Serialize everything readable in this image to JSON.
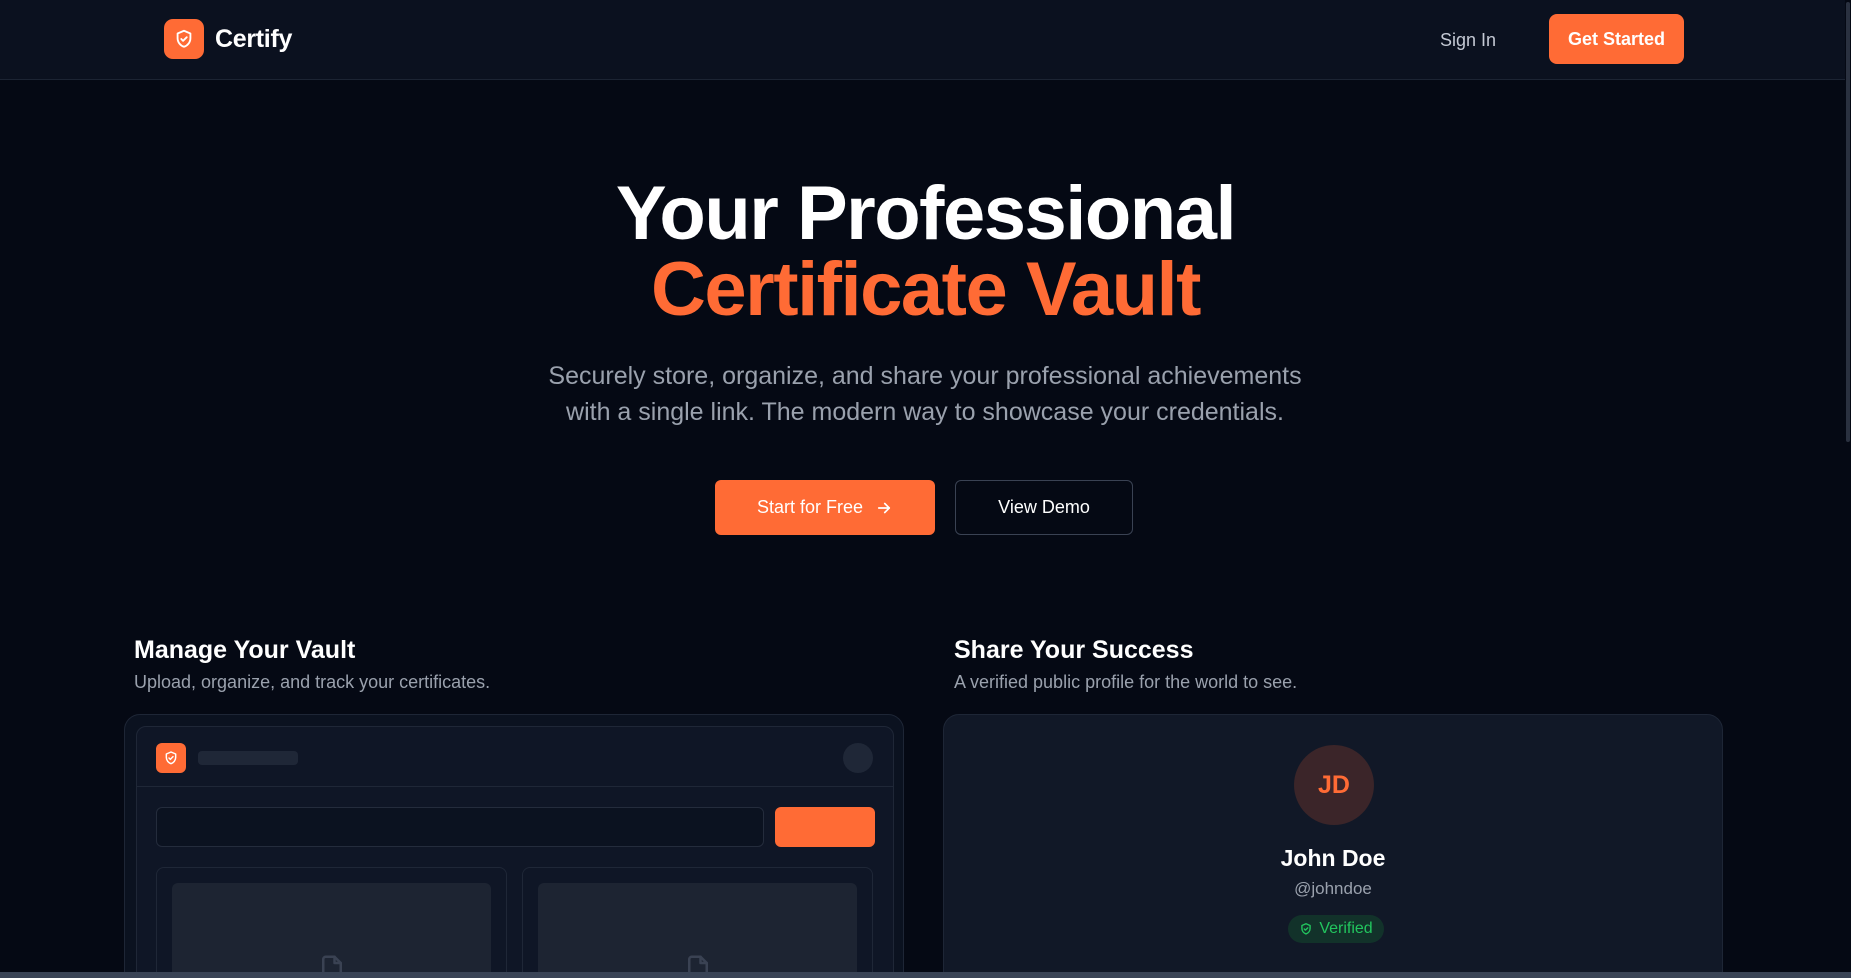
{
  "brand": {
    "name": "Certify",
    "accent": "#ff6b35",
    "icon": "shield-check-icon"
  },
  "nav": {
    "signin": "Sign In",
    "cta": "Get Started"
  },
  "hero": {
    "title_line1": "Your Professional",
    "title_line2": "Certificate Vault",
    "subtitle_line1": "Securely store, organize, and share your professional achievements",
    "subtitle_line2": "with a single link. The modern way to showcase your credentials.",
    "primary_button": "Start for Free",
    "primary_icon": "arrow-right-icon",
    "secondary_button": "View Demo"
  },
  "features": {
    "vault": {
      "title": "Manage Your Vault",
      "subtitle": "Upload, organize, and track your certificates."
    },
    "share": {
      "title": "Share Your Success",
      "subtitle": "A verified public profile for the world to see."
    }
  },
  "profile": {
    "initials": "JD",
    "name": "John Doe",
    "handle": "@johndoe",
    "badge": "Verified",
    "badge_color": "#22c55e"
  }
}
